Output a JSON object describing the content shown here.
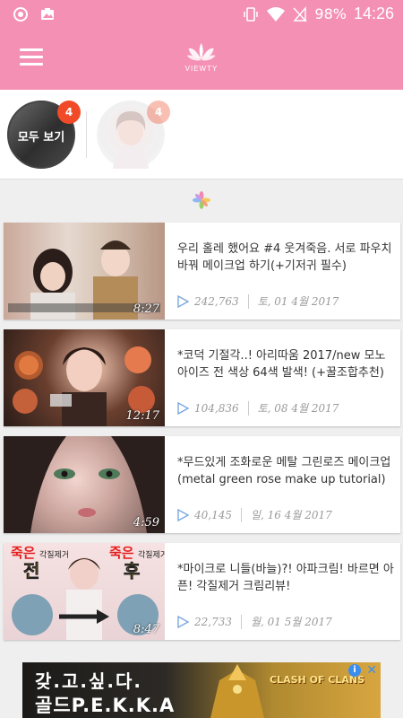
{
  "statusbar": {
    "battery": "98%",
    "time": "14:26"
  },
  "appbar": {
    "logo_text": "VIEWTY"
  },
  "creators": [
    {
      "label": "모두 보기",
      "badge": "4"
    },
    {
      "label": "",
      "badge": "4"
    }
  ],
  "videos": [
    {
      "title": "우리 홀레 했어요 #4 웃겨죽음. 서로 파우치 바꿔 메이크업 하기(+기저귀 필수)",
      "duration": "8:27",
      "views": "242,763",
      "date": "토, 01 4월 2017"
    },
    {
      "title": "*코덕 기절각..! 아리따움 2017/new 모노 아이즈 전 색상 64색 발색! (+꿀조합추천)",
      "duration": "12:17",
      "views": "104,836",
      "date": "토, 08 4월 2017"
    },
    {
      "title": "*무드있게 조화로운 메탈 그린로즈 메이크업 (metal green rose make up tutorial)",
      "duration": "4:59",
      "views": "40,145",
      "date": "일, 16 4월 2017"
    },
    {
      "title": "*마이크로 니들(바늘)?! 아파크림! 바르면 아픈! 각질제거 크림리뷰!",
      "duration": "8:47",
      "views": "22,733",
      "date": "월, 01 5월 2017"
    }
  ],
  "thumb4_text": {
    "left_top": "죽은",
    "left_small": "각질제거",
    "left_big": "전",
    "right_top": "죽은",
    "right_small": "각질제거",
    "right_big": "후"
  },
  "ad": {
    "line1": "갖.고.싶.다.",
    "line2": "골드P.E.K.K.A",
    "game": "CLASH OF CLANS",
    "close": "✕",
    "info": "i"
  },
  "colors": {
    "primary": "#f490b4",
    "badge": "#f04a28"
  }
}
